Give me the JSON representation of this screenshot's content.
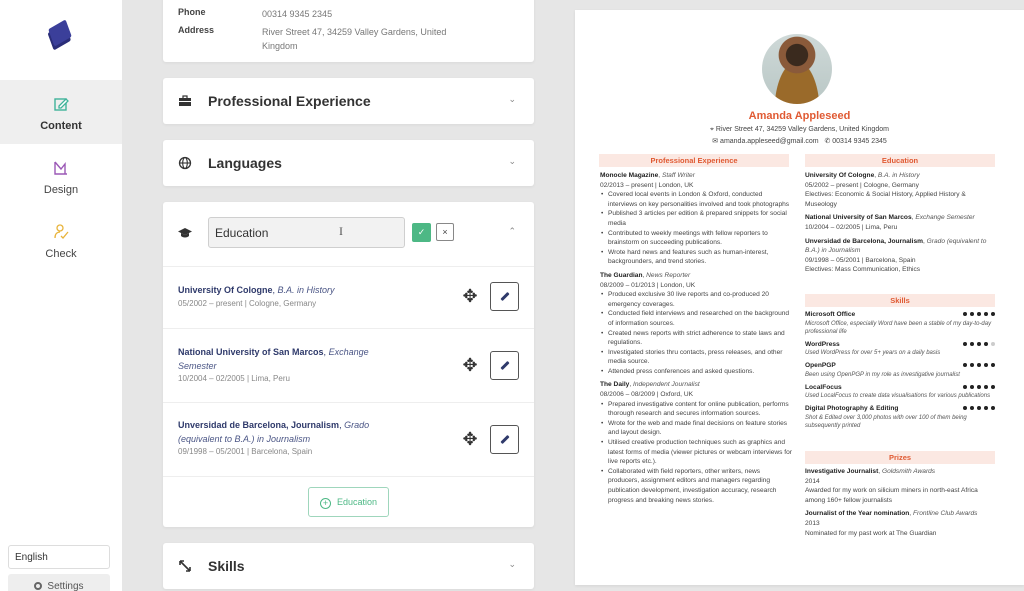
{
  "sidebar": {
    "nav": [
      {
        "label": "Content",
        "icon": "edit-icon",
        "active": true
      },
      {
        "label": "Design",
        "icon": "design-icon",
        "active": false
      },
      {
        "label": "Check",
        "icon": "check-icon",
        "active": false
      }
    ],
    "language": "English",
    "settings_label": "Settings"
  },
  "editor": {
    "contact": {
      "phone_label": "Phone",
      "phone_value": "00314 9345 2345",
      "address_label": "Address",
      "address_value": "River Street 47, 34259 Valley Gardens, United Kingdom"
    },
    "sections": {
      "experience": "Professional Experience",
      "languages": "Languages",
      "skills": "Skills"
    },
    "education": {
      "title_input": "Education",
      "confirm_icon": "✓",
      "cancel_icon": "×",
      "items": [
        {
          "school": "University Of Cologne",
          "degree": "B.A. in History",
          "details": "05/2002 – present  |  Cologne, Germany"
        },
        {
          "school": "National University of San Marcos",
          "degree": "Exchange Semester",
          "details": "10/2004 – 02/2005  |  Lima, Peru"
        },
        {
          "school": "Unversidad de Barcelona, Journalism",
          "degree": "Grado (equivalent to B.A.) in Journalism",
          "details": "09/1998 – 05/2001  |  Barcelona, Spain"
        }
      ],
      "add_label": "Education"
    }
  },
  "resume": {
    "name": "Amanda Appleseed",
    "address": "River Street 47, 34259 Valley Gardens, United Kingdom",
    "email": "amanda.appleseed@gmail.com",
    "phone": "00314 9345 2345",
    "accent_color": "#e05a33",
    "headings": {
      "experience": "Professional Experience",
      "education": "Education",
      "skills": "Skills",
      "prizes": "Prizes"
    },
    "experience": [
      {
        "org": "Monocle Magazine",
        "role": "Staff Writer",
        "meta": "02/2013 – present | London, UK",
        "bullets": [
          "Covered local events in London & Oxford, conducted interviews on key personalities involved and took photographs",
          "Published 3 articles per edition & prepared snippets for social media",
          "Contributed to weekly meetings with fellow reporters to brainstorm on succeeding publications.",
          "Wrote hard news and features such as human-interest, backgrounders, and trend stories."
        ]
      },
      {
        "org": "The Guardian",
        "role": "News Reporter",
        "meta": "08/2009 – 01/2013 | London, UK",
        "bullets": [
          "Produced exclusive 30 live reports and co-produced 20 emergency coverages.",
          "Conducted field interviews and researched on the background of information sources.",
          "Created news reports with strict adherence to state laws and regulations.",
          "Investigated stories thru contacts, press releases, and other media source.",
          "Attended press conferences and asked questions."
        ]
      },
      {
        "org": "The Daily",
        "role": "Independent Journalist",
        "meta": "08/2006 – 08/2009 | Oxford, UK",
        "bullets": [
          "Prepared investigative content for online publication, performs thorough research and secures information sources.",
          "Wrote for the web and made final decisions on feature stories and layout design.",
          "Utilised creative production techniques such as graphics and latest forms of media (viewer pictures or webcam interviews for live reports etc.).",
          "Collaborated with field reporters, other writers, news producers, assignment editors and managers regarding publication development, investigation accuracy, research progress and breaking news stories."
        ]
      }
    ],
    "education": [
      {
        "school": "University Of Cologne",
        "degree": "B.A. in History",
        "meta": "05/2002 – present | Cologne, Germany",
        "extra": "Electives: Economic & Social History, Applied History & Museology"
      },
      {
        "school": "National University of San Marcos",
        "degree": "Exchange Semester",
        "meta": "10/2004 – 02/2005 | Lima, Peru",
        "extra": ""
      },
      {
        "school": "Unversidad de Barcelona, Journalism",
        "degree": "Grado (equivalent to B.A.) in Journalism",
        "meta": "09/1998 – 05/2001 | Barcelona, Spain",
        "extra": "Electives: Mass Communication, Ethics"
      }
    ],
    "skills": [
      {
        "name": "Microsoft Office",
        "desc": "Microsoft Office, especially Word have been a stable of my day-to-day professional life",
        "rating": 5,
        "max": 5
      },
      {
        "name": "WordPress",
        "desc": "Used WordPress for over 5+ years on a daily basis",
        "rating": 4,
        "max": 5
      },
      {
        "name": "OpenPGP",
        "desc": "Been using OpenPGP in my role as investigative journalist",
        "rating": 5,
        "max": 5
      },
      {
        "name": "LocalFocus",
        "desc": "Used LocalFocus to create data visualisations for various publications",
        "rating": 5,
        "max": 5
      },
      {
        "name": "Digital Photography & Editing",
        "desc": "Shot & Edited over 3,000 photos with over 100 of them being subsequently printed",
        "rating": 5,
        "max": 5
      }
    ],
    "prizes": [
      {
        "title": "Investigative Journalist",
        "org": "Goldsmith Awards",
        "year": "2014",
        "desc": "Awarded for my work on silicium miners in north-east Africa among 160+ fellow journalists"
      },
      {
        "title": "Journalist of the Year nomination",
        "org": "Frontline Club Awards",
        "year": "2013",
        "desc": "Nominated for my past work at The Guardian"
      }
    ]
  }
}
